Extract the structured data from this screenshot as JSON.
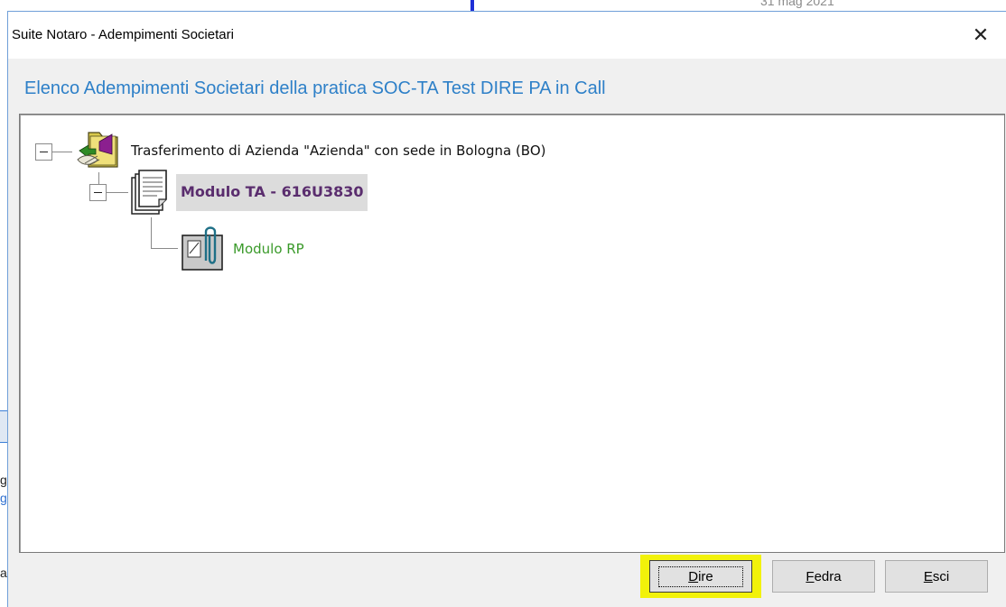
{
  "background": {
    "date_text": "31 mag 2021",
    "left_fragments": [
      "g",
      "g",
      "a"
    ]
  },
  "dialog": {
    "title": "Suite Notaro - Adempimenti Societari",
    "close_glyph": "✕",
    "heading": "Elenco Adempimenti Societari della pratica SOC-TA Test DIRE PA in Call"
  },
  "tree": {
    "root": {
      "label": "Trasferimento di Azienda \"Azienda\" con sede in Bologna (BO)",
      "icon": "folder-handshake-icon",
      "expanded": true
    },
    "module": {
      "label": "Modulo TA - 616U3830",
      "icon": "document-stack-icon",
      "expanded": true,
      "selected": true
    },
    "attachment": {
      "label": "Modulo RP",
      "icon": "paperclip-attachment-icon"
    }
  },
  "buttons": {
    "dire": {
      "accel": "D",
      "rest": "ire"
    },
    "fedra": {
      "accel": "F",
      "rest": "edra"
    },
    "esci": {
      "accel": "E",
      "rest": "sci"
    }
  },
  "colors": {
    "heading": "#2e80c8",
    "selected_label": "#5a2d6e",
    "child_label": "#3a9a2a",
    "highlight": "#f2f20a"
  }
}
